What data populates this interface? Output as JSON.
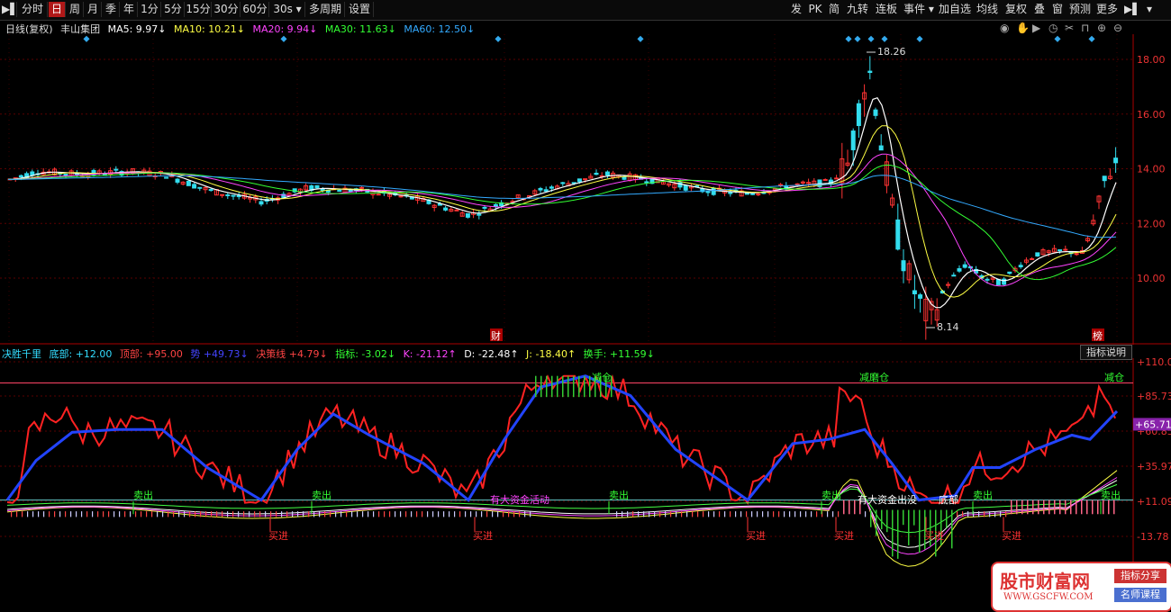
{
  "toolbar": {
    "left": [
      "分时",
      "日",
      "周",
      "月",
      "季",
      "年",
      "1分",
      "5分",
      "15分",
      "30分",
      "60分",
      "30s ▾",
      "多周期",
      "设置"
    ],
    "right": [
      "发",
      "PK",
      "简",
      "九转",
      "连板",
      "事件 ▾",
      "加自选",
      "均线",
      "复权",
      "叠",
      "窗",
      "预测",
      "更多"
    ]
  },
  "main_header": {
    "period": "日线(复权)",
    "stock": "丰山集团",
    "ma5": "MA5: 9.97↓",
    "ma10": "MA10: 10.21↓",
    "ma20": "MA20: 9.94↓",
    "ma30": "MA30: 11.63↓",
    "ma60": "MA60: 12.50↓"
  },
  "main_axis": [
    "18.00",
    "16.00",
    "14.00",
    "12.00",
    "10.00"
  ],
  "main_marks": {
    "high": "18.26",
    "low": "8.14",
    "cai": "财",
    "bang": "榜"
  },
  "sub_header": {
    "name": "决胜千里",
    "dibu": "底部: +12.00",
    "dingbu": "顶部: +95.00",
    "shi": "势 +49.73↓",
    "juece": "决策线 +4.79↓",
    "zhibiao": "指标: -3.02↓",
    "k": "K: -21.12↑",
    "d": "D: -22.48↑",
    "j": "J: -18.40↑",
    "huanshou": "换手: +11.59↓"
  },
  "sub_axis": [
    "+110.0",
    "+85.73",
    "+60.85",
    "+35.97",
    "+11.09",
    "-13.78"
  ],
  "sub_current": "+65.71",
  "sub_labels": {
    "sell": "卖出",
    "buy": "买进",
    "jiecang": "减仓",
    "jiecang2": "减磨仓",
    "bigfund": "有大资金活动",
    "bigfund2": "有大资金出没",
    "bottom": "底部"
  },
  "explain_button": "指标说明",
  "watermark": {
    "title": "股市财富网",
    "url": "WWW.GSCFW.COM",
    "tag1": "指标分享",
    "tag2": "名师课程"
  },
  "colors": {
    "up": "#ff3333",
    "down": "#33ddee",
    "ma5": "#ffffff",
    "ma10": "#ffff44",
    "ma20": "#ff44ff",
    "ma30": "#33ff33",
    "ma60": "#33aaff"
  }
}
